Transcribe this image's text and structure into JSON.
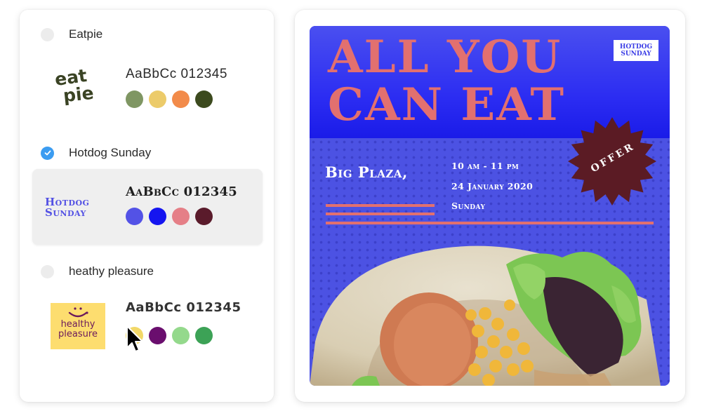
{
  "brand_options": [
    {
      "name": "Eatpie",
      "selected": false,
      "logo_text": [
        "eat",
        "pie"
      ],
      "sample_text": "AaBbCc 012345",
      "colors": [
        "#7f9663",
        "#eccb6a",
        "#f28b4a",
        "#3c4a1e"
      ]
    },
    {
      "name": "Hotdog Sunday",
      "selected": true,
      "logo_text": [
        "Hotdog",
        "Sunday"
      ],
      "sample_text": "AaBbCc 012345",
      "colors": [
        "#5352e6",
        "#1515f0",
        "#e57f87",
        "#5a1b2b"
      ]
    },
    {
      "name": "heathy pleasure",
      "selected": false,
      "logo_text": [
        "healthy",
        "pleasure"
      ],
      "sample_text": "AaBbCc 012345",
      "colors": [
        "#f2d868",
        "#6a0e6e",
        "#94d98c",
        "#3ca256"
      ]
    }
  ],
  "poster": {
    "headline": [
      "ALL YOU",
      "CAN EAT"
    ],
    "logo_text": [
      "Hotdog",
      "Sunday"
    ],
    "badge_text": "OFFER",
    "venue": "Big Plaza,",
    "time": "10 am - 11 pm",
    "date": "24 January 2020",
    "day": "Sunday",
    "colors": {
      "background": "#4c52e3",
      "headline": "#e2706f",
      "badge": "#5b1b24"
    }
  },
  "cursor": "pointer-arrow"
}
